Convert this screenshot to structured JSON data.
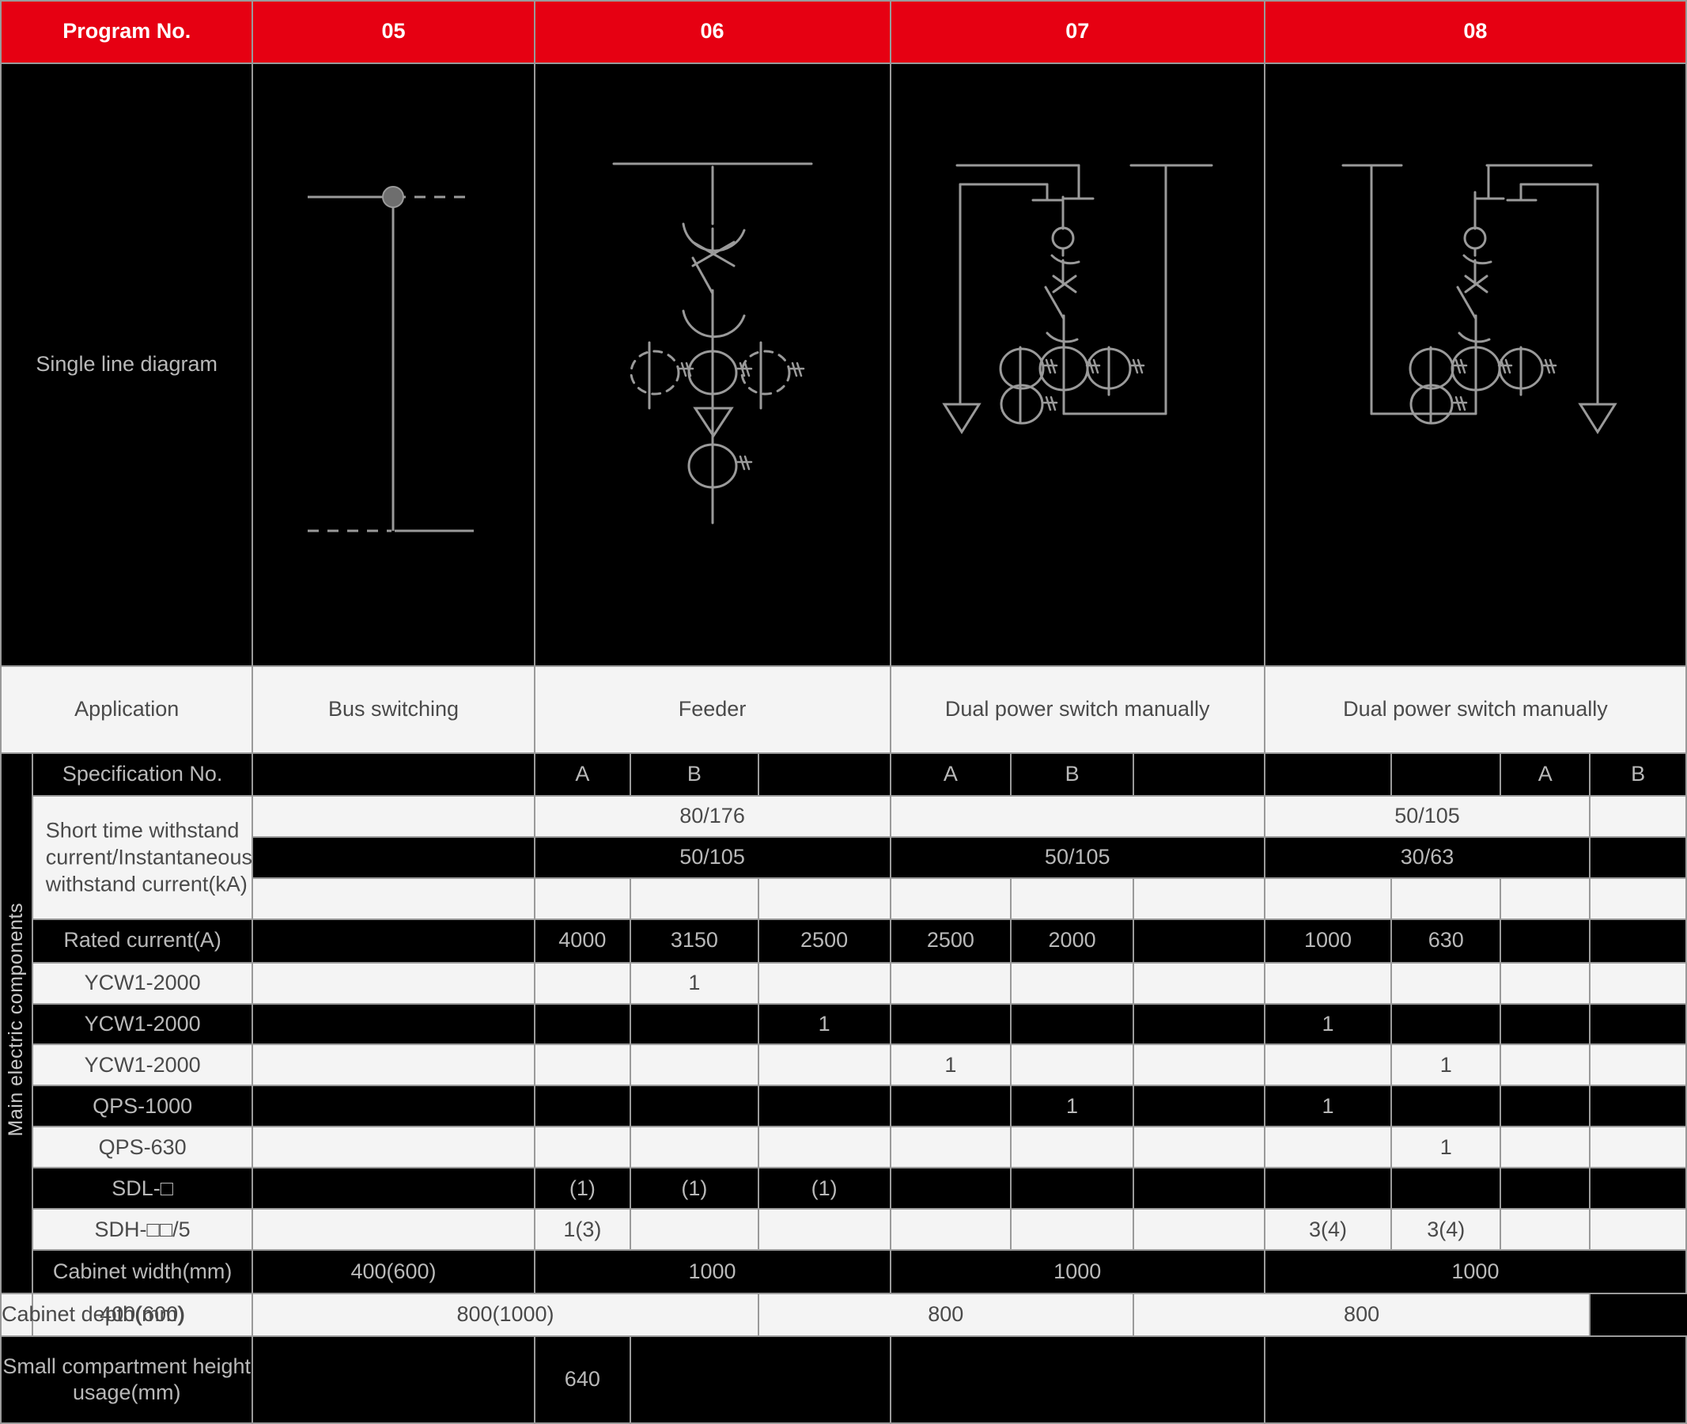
{
  "header": {
    "row_label": "Program No.",
    "programs": [
      "05",
      "06",
      "07",
      "08"
    ]
  },
  "rows": {
    "single_line_diagram_label": "Single line diagram",
    "application_label": "Application",
    "spec_no_label": "Specification No.",
    "withstand_label": "Short time withstand current/Instantaneous withstand current(kA)",
    "rated_current_label": "Rated current(A)",
    "cabinet_width_label": "Cabinet width(mm)",
    "cabinet_depth_label": "Cabinet depth(mm)",
    "small_compartment_label": "Small compartment height usage(mm)",
    "side_label": "Main electric components"
  },
  "application": {
    "p05": "Bus switching",
    "p06": "Feeder",
    "p07": "Dual power switch manually",
    "p08": "Dual power switch manually"
  },
  "spec_no": {
    "c1": "A",
    "c2": "B",
    "c3": "",
    "c4": "A",
    "c5": "B",
    "c6": "",
    "c7": "",
    "c8": "",
    "c9": "A",
    "c10": "B"
  },
  "withstand": {
    "row1": {
      "p06": "80/176",
      "p07": "",
      "p08": "50/105"
    },
    "row2": {
      "p06": "50/105",
      "p07": "50/105",
      "p08": "30/63"
    },
    "row3": {
      "p06": "",
      "p07": "",
      "p08": ""
    }
  },
  "rated_current": {
    "c1": "4000",
    "c2": "3150",
    "c3": "2500",
    "c4": "2500",
    "c5": "2000",
    "c6": "",
    "c7": "1000",
    "c8": "630",
    "c9": "",
    "c10": ""
  },
  "components": [
    {
      "label": "YCW1-2000",
      "values": [
        "",
        "1",
        "",
        "",
        "",
        "",
        "",
        "",
        "",
        ""
      ]
    },
    {
      "label": "YCW1-2000",
      "values": [
        "",
        "",
        "1",
        "",
        "",
        "",
        "1",
        "",
        "",
        ""
      ]
    },
    {
      "label": "YCW1-2000",
      "values": [
        "",
        "",
        "",
        "1",
        "",
        "",
        "",
        "1",
        "",
        ""
      ]
    },
    {
      "label": "QPS-1000",
      "values": [
        "",
        "",
        "",
        "",
        "1",
        "",
        "1",
        "",
        "",
        ""
      ]
    },
    {
      "label": "QPS-630",
      "values": [
        "",
        "",
        "",
        "",
        "",
        "",
        "",
        "1",
        "",
        ""
      ]
    },
    {
      "label": "SDL-□",
      "values": [
        "(1)",
        "(1)",
        "(1)",
        "",
        "",
        "",
        "",
        "",
        "",
        ""
      ]
    },
    {
      "label": "SDH-□□/5",
      "values": [
        "1(3)",
        "",
        "",
        "",
        "",
        "",
        "3(4)",
        "3(4)",
        "",
        ""
      ]
    }
  ],
  "cabinet_width": {
    "p05": "400(600)",
    "p06": "1000",
    "p07": "1000",
    "p08": "1000"
  },
  "cabinet_depth": {
    "p05": "400(600)",
    "p06": "800(1000)",
    "p07": "800",
    "p08": "800"
  },
  "small_compartment": {
    "p06a": "640",
    "p06b": "",
    "p07": "",
    "p08": ""
  },
  "colors": {
    "header_red": "#E60012",
    "dark_fill": "#000000",
    "light_fill": "#f4f4f4",
    "grid_line": "#9a9a9a",
    "diagram_stroke": "#9a9a9a",
    "node_fill": "#6e6e6e"
  },
  "diagrams": {
    "d05": "bus-switching-single-line-diagram",
    "d06": "feeder-single-line-diagram",
    "d07": "dual-power-switch-manual-diagram-a",
    "d08": "dual-power-switch-manual-diagram-b"
  }
}
